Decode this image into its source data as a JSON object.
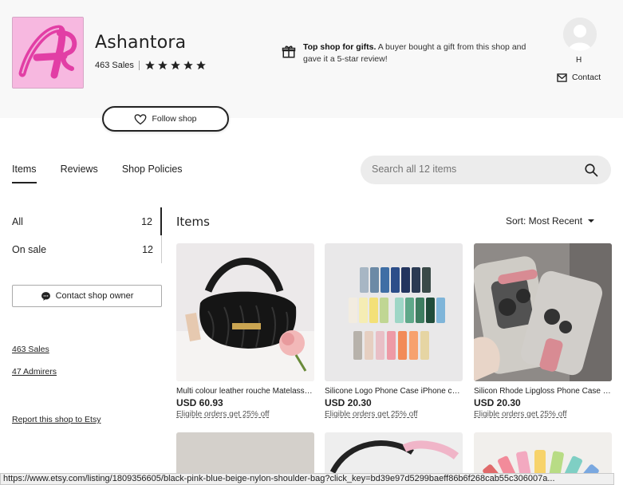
{
  "shop": {
    "name": "Ashantora",
    "sales": "463 Sales",
    "rating_stars": 5,
    "follow_label": "Follow shop",
    "top_shop_bold": "Top shop for gifts.",
    "top_shop_text": "A buyer bought a gift from this shop and gave it a 5-star review!",
    "owner_initial": "H",
    "contact_label": "Contact"
  },
  "tabs": [
    "Items",
    "Reviews",
    "Shop Policies"
  ],
  "search": {
    "placeholder": "Search all 12 items"
  },
  "sidebar": {
    "categories": [
      {
        "label": "All",
        "count": "12"
      },
      {
        "label": "On sale",
        "count": "12"
      }
    ],
    "contact_owner": "Contact shop owner",
    "sales_link": "463 Sales",
    "admirers_link": "47 Admirers",
    "report_link": "Report this shop to Etsy"
  },
  "main": {
    "title": "Items",
    "sort_label": "Sort: Most Recent"
  },
  "listings": [
    {
      "title": "Multi colour leather rouche Matelasse shoulder bag",
      "price": "USD 60.93",
      "promo": "Eligible orders get 25% off"
    },
    {
      "title": "Silicone Logo Phone Case iPhone cases",
      "price": "USD 20.30",
      "promo": "Eligible orders get 25% off"
    },
    {
      "title": "Silicon Rhode Lipgloss Phone Case iPhone",
      "price": "USD 20.30",
      "promo": "Eligible orders get 25% off"
    }
  ],
  "status_url": "https://www.etsy.com/listing/1809356605/black-pink-blue-beige-nylon-shoulder-bag?click_key=bd39e97d5299baeff86b6f268cab55c306007a...",
  "colors": {
    "accent": "#222222",
    "logo_bg": "#f7b8e0",
    "logo_fg": "#e23ea5"
  },
  "icons": [
    "gift-icon",
    "mail-icon",
    "heart-icon",
    "search-icon",
    "chat-icon",
    "caret-down-icon",
    "star-icon"
  ]
}
